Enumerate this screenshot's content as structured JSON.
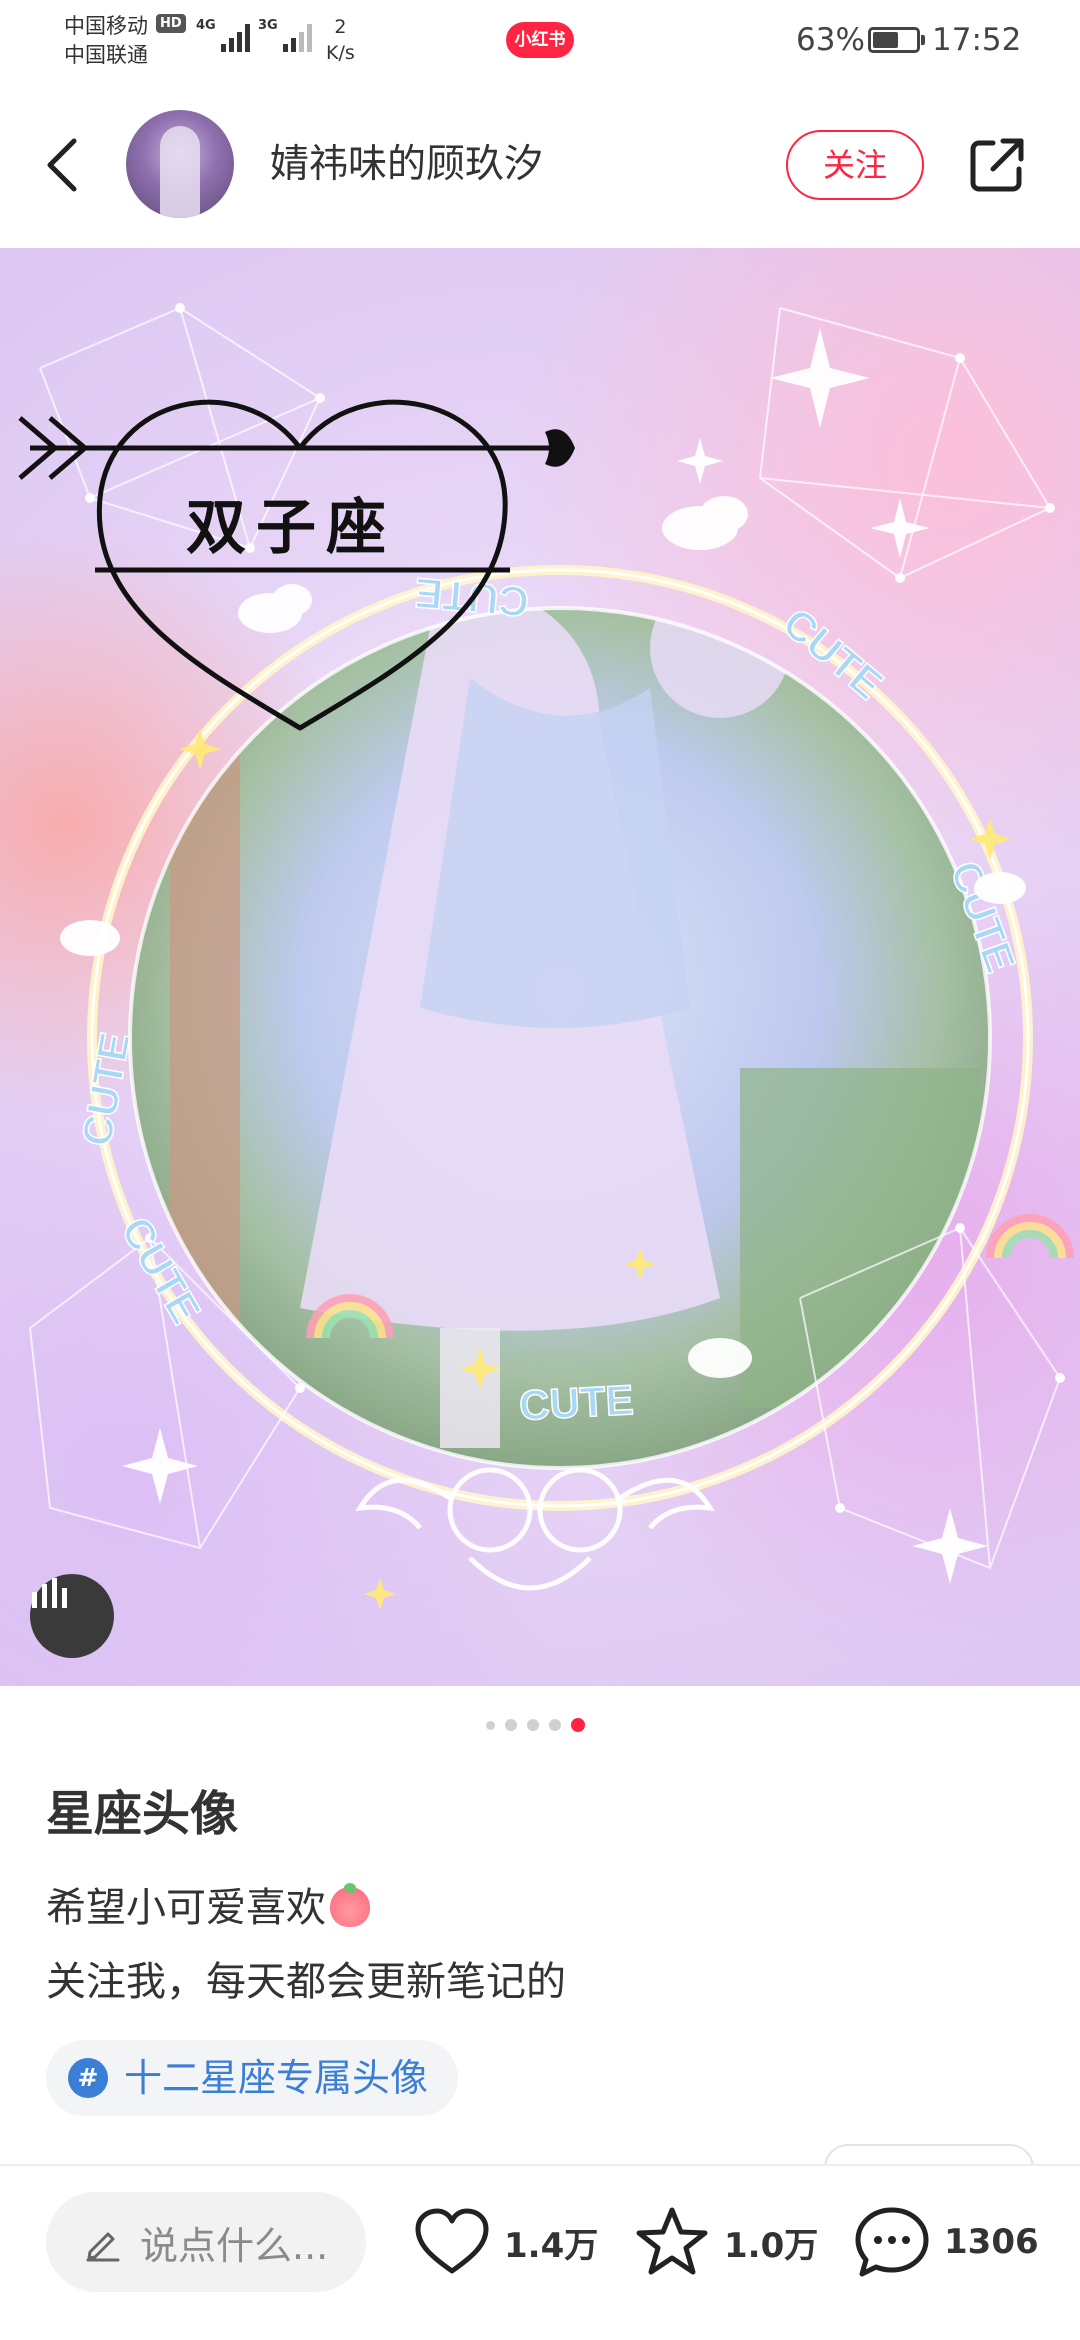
{
  "status_bar": {
    "carrier_1": "中国移动",
    "carrier_2": "中国联通",
    "hd_badge": "HD",
    "net_1": "4G",
    "net_2": "3G",
    "speed_value": "2",
    "speed_unit": "K/s",
    "app_badge": "小红书",
    "battery_percent": "63%",
    "battery_level": 0.63,
    "time": "17:52"
  },
  "header": {
    "back_icon": "chevron-left-icon",
    "username": "婧祎味的顾玖汐",
    "follow_label": "关注",
    "share_icon": "share-icon",
    "accent_color": "#ff2442"
  },
  "post": {
    "image_text": {
      "heart_title": "双子座",
      "ring_words": [
        "CUTE",
        "CUTE",
        "CUTE",
        "CUTE",
        "CUTE",
        "CUTE"
      ]
    },
    "audio_icon": "audio-bars-icon",
    "pager": {
      "count": 5,
      "active_index": 4
    },
    "title": "星座头像",
    "body_line_1": "希望小可爱喜欢",
    "body_line_2": "关注我，每天都会更新笔记的",
    "hashtag_symbol": "#",
    "hashtag": "十二星座专属头像"
  },
  "bottom_bar": {
    "comment_placeholder": "说点什么...",
    "pen_icon": "pen-icon",
    "like_icon": "heart-icon",
    "like_count": "1.4万",
    "collect_icon": "star-icon",
    "collect_count": "1.0万",
    "comment_icon": "comment-bubble-icon",
    "comment_count": "1306"
  }
}
